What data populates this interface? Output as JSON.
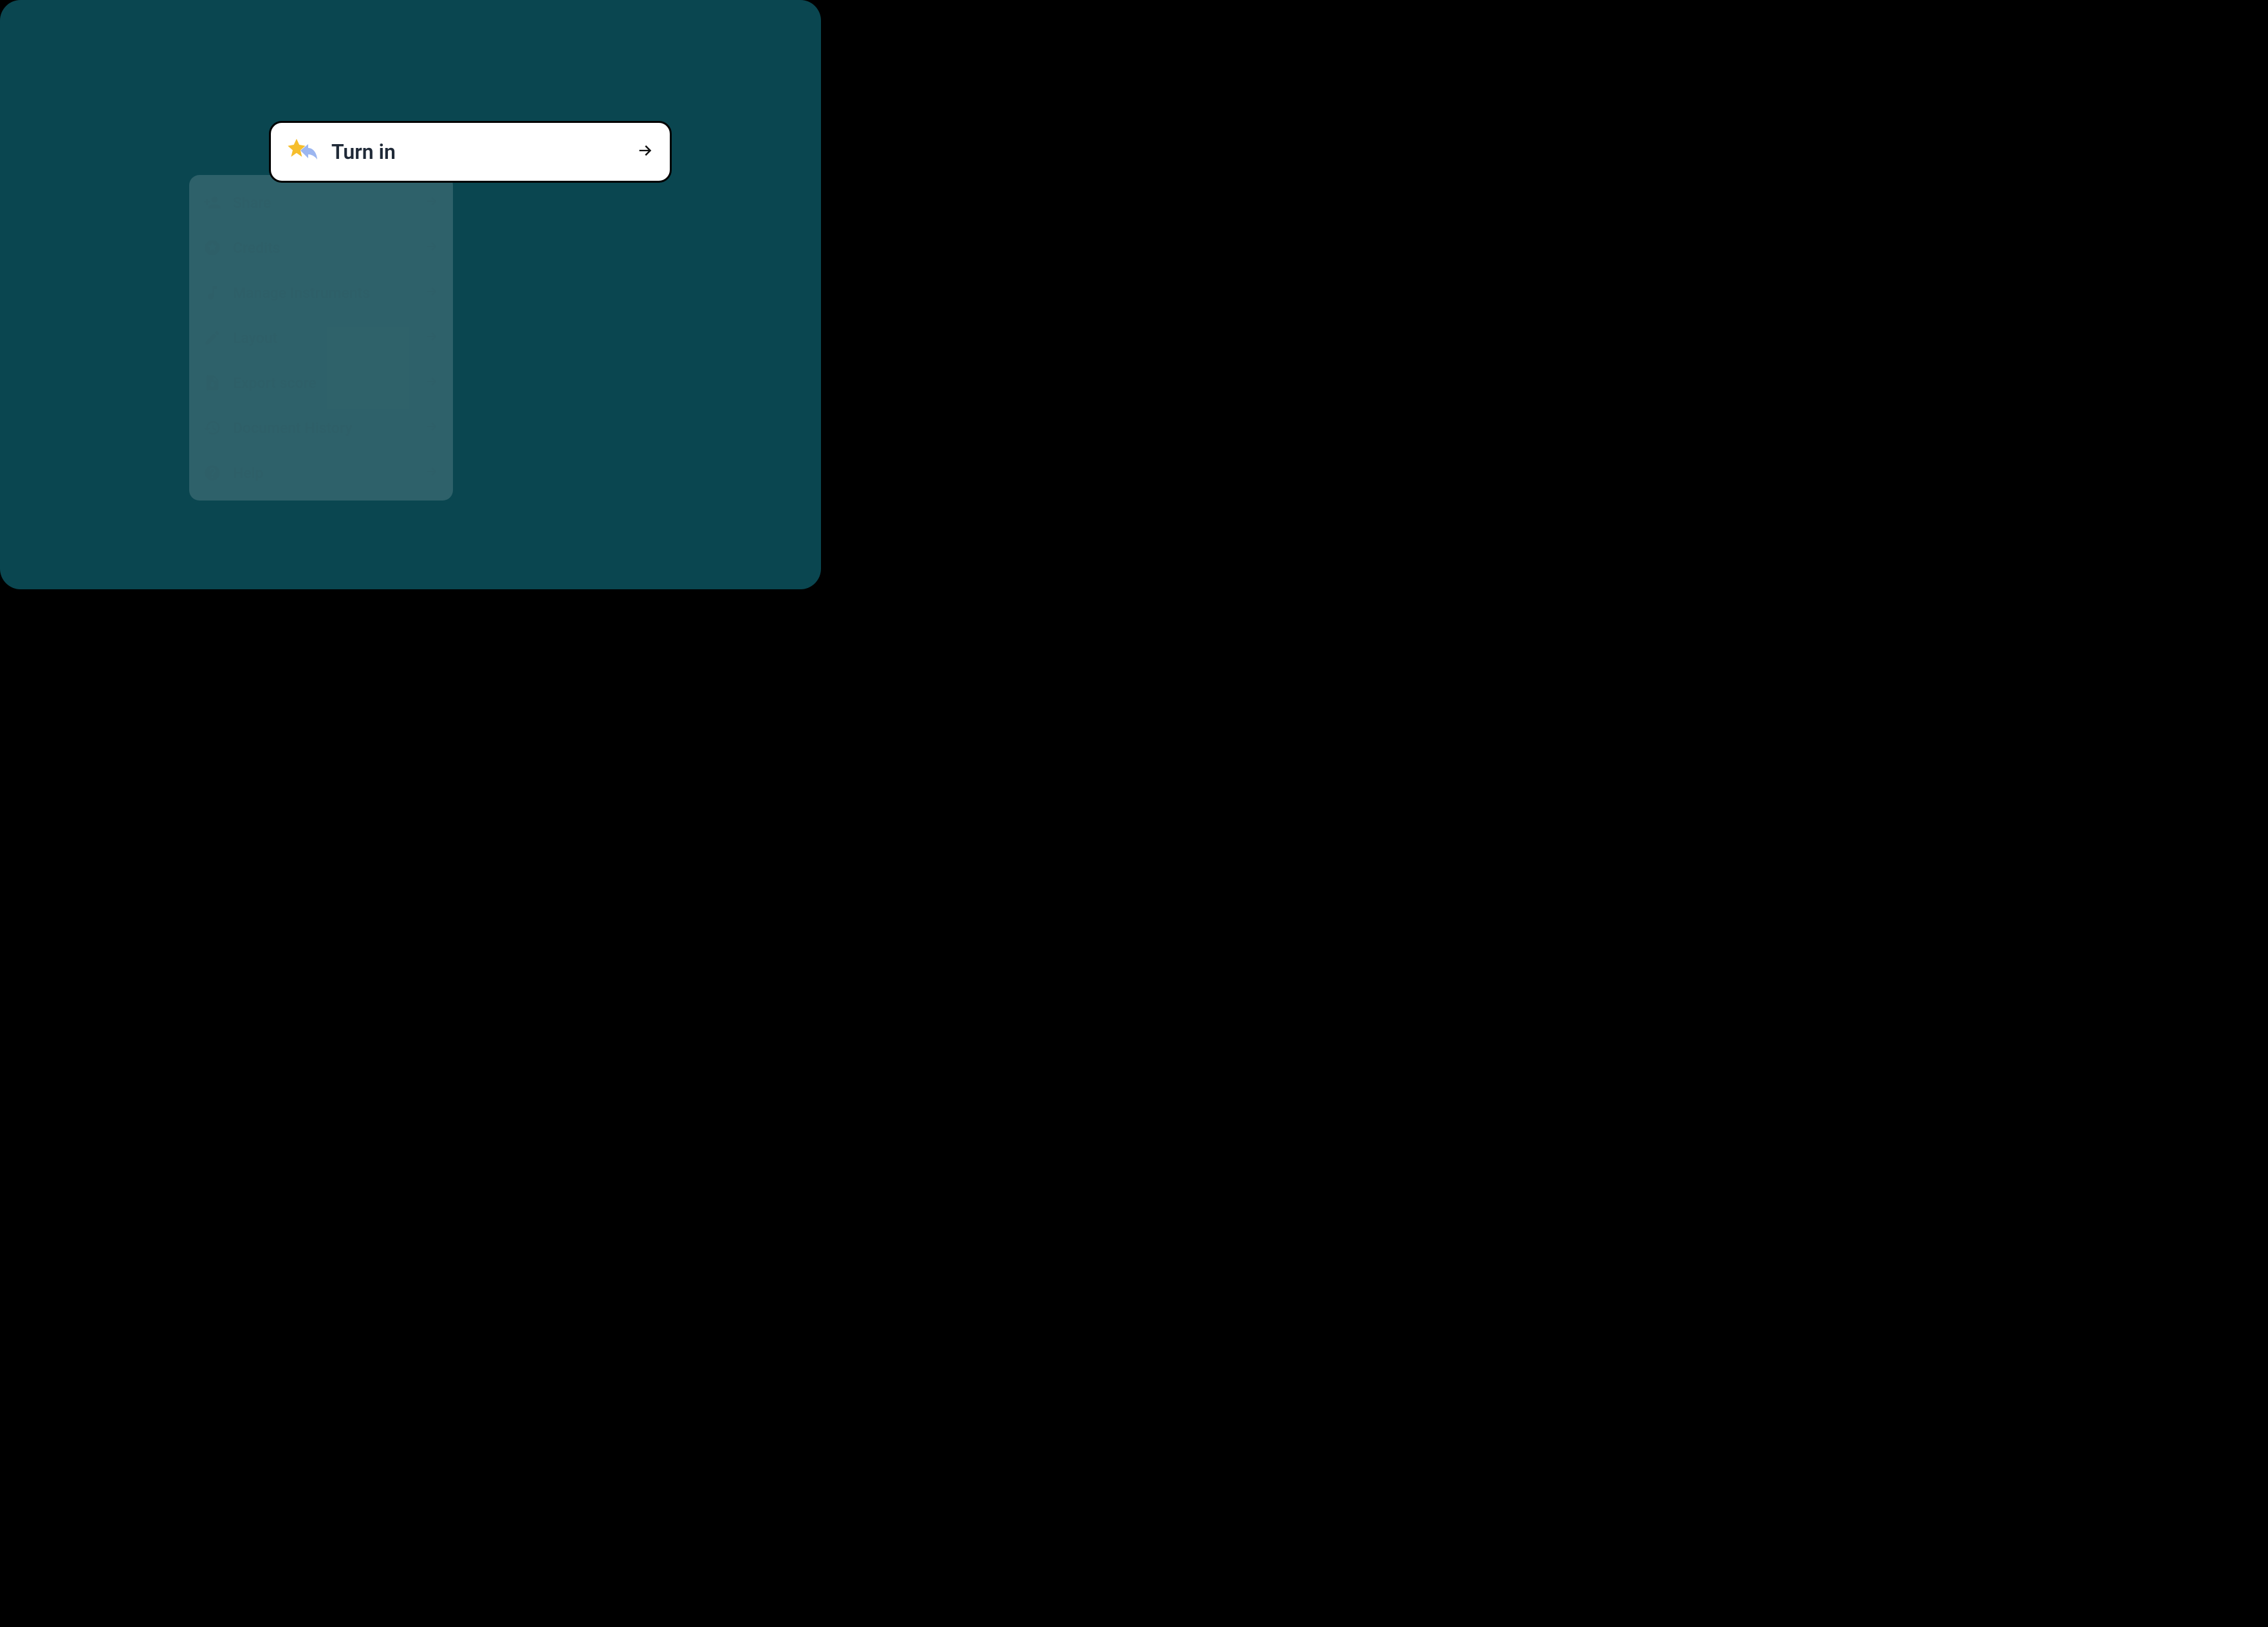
{
  "highlight": {
    "label": "Turn in"
  },
  "menu": {
    "items": [
      {
        "label": "Share"
      },
      {
        "label": "Credits"
      },
      {
        "label": "Manage Instruments"
      },
      {
        "label": "Layout"
      },
      {
        "label": "Export score"
      },
      {
        "label": "Document History"
      },
      {
        "label": "Help"
      }
    ]
  }
}
